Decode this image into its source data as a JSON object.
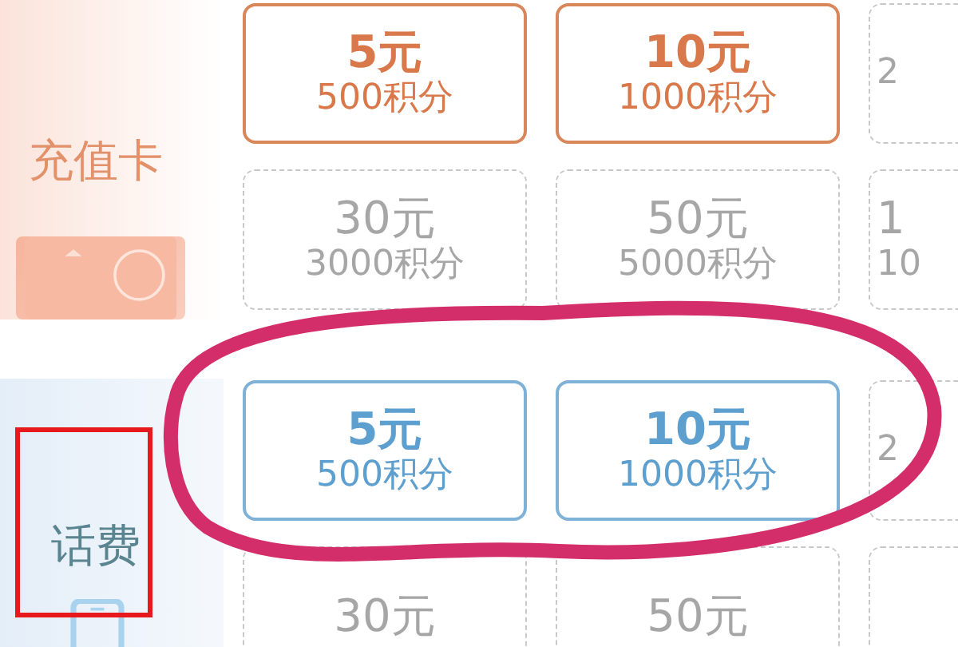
{
  "sections": [
    {
      "label": "充值卡",
      "kind": "card",
      "rows": [
        [
          {
            "kind": "full",
            "available": true,
            "price": "5元",
            "points": "500积分"
          },
          {
            "kind": "full",
            "available": true,
            "price": "10元",
            "points": "1000积分"
          },
          {
            "kind": "partial",
            "available": false,
            "points": "2"
          }
        ],
        [
          {
            "kind": "full",
            "available": false,
            "price": "30元",
            "points": "3000积分"
          },
          {
            "kind": "full",
            "available": false,
            "price": "50元",
            "points": "5000积分"
          },
          {
            "kind": "partial",
            "available": false,
            "price": "1",
            "points": "10"
          }
        ]
      ]
    },
    {
      "label": "话费",
      "kind": "phone",
      "rows": [
        [
          {
            "kind": "full",
            "available": true,
            "price": "5元",
            "points": "500积分"
          },
          {
            "kind": "full",
            "available": true,
            "price": "10元",
            "points": "1000积分"
          },
          {
            "kind": "partial",
            "available": false,
            "points": "2"
          }
        ],
        [
          {
            "kind": "full",
            "available": false,
            "price": "30元"
          },
          {
            "kind": "full",
            "available": false,
            "price": "50元"
          },
          {
            "kind": "partial",
            "available": false
          }
        ]
      ]
    }
  ],
  "annotations": [
    {
      "kind": "rectangle",
      "color": "#e8191c"
    },
    {
      "kind": "ellipse",
      "color": "#d42e6a"
    }
  ]
}
